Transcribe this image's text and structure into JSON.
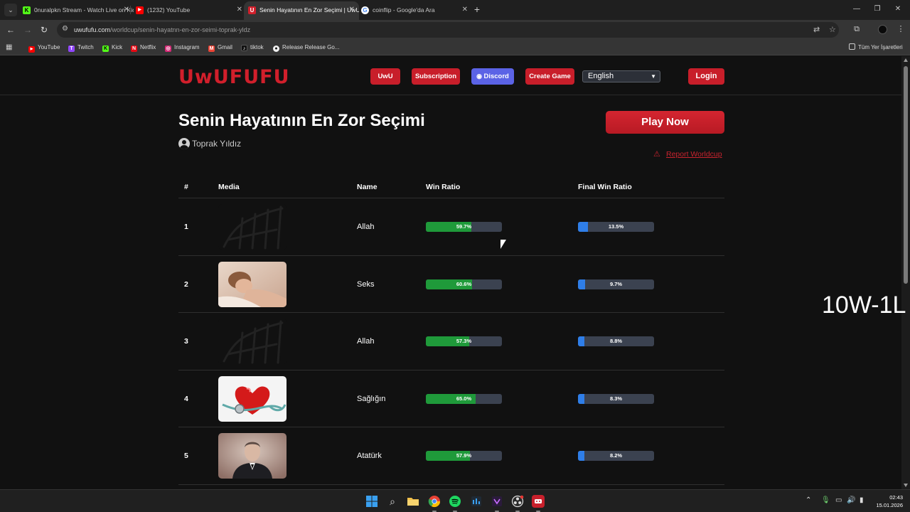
{
  "browser": {
    "tabs": [
      {
        "title": "0nuralpkn Stream - Watch Live on Kick",
        "favicon_color": "#53fc18",
        "favicon_letter": "K",
        "active": false
      },
      {
        "title": "(1232) YouTube",
        "favicon_color": "#ff0000",
        "favicon_letter": "▶",
        "active": false
      },
      {
        "title": "Senin Hayatının En Zor Seçimi | UwUFUFU",
        "favicon_color": "#d11f2b",
        "favicon_letter": "U",
        "active": true
      },
      {
        "title": "coinflip - Google'da Ara",
        "favicon_color": "#ffffff",
        "favicon_letter": "G",
        "active": false
      }
    ],
    "url_domain": "uwufufu.com",
    "url_path": "/worldcup/senin-hayatnn-en-zor-seimi-toprak-yldz",
    "bookmarks": [
      {
        "label": "YouTube",
        "color": "#ff0000",
        "glyph": "▶"
      },
      {
        "label": "Twitch",
        "color": "#9146ff",
        "glyph": "T"
      },
      {
        "label": "Kick",
        "color": "#53fc18",
        "glyph": "K"
      },
      {
        "label": "Netflix",
        "color": "#e50914",
        "glyph": "N"
      },
      {
        "label": "Instagram",
        "color": "#d62976",
        "glyph": "◎"
      },
      {
        "label": "Gmail",
        "color": "#ea4335",
        "glyph": "M"
      },
      {
        "label": "tiktok",
        "color": "#111111",
        "glyph": "♪"
      },
      {
        "label": "Release Release Go...",
        "color": "#f0f0f0",
        "glyph": "●"
      }
    ],
    "bookmarks_all": "Tüm Yer İşaretleri"
  },
  "site": {
    "logo": "UwUFUFU",
    "nav": {
      "uwu": "UwU",
      "subscription": "Subscription",
      "discord": "Discord",
      "create_game": "Create Game",
      "language": "English",
      "login": "Login"
    }
  },
  "worldcup": {
    "title": "Senin Hayatının En Zor Seçimi",
    "author": "Toprak Yıldız",
    "play_now": "Play Now",
    "report": "Report Worldcup"
  },
  "table": {
    "headers": {
      "rank": "#",
      "media": "Media",
      "name": "Name",
      "win_ratio": "Win Ratio",
      "final_win_ratio": "Final Win Ratio"
    },
    "rows": [
      {
        "rank": "1",
        "name": "Allah",
        "win_ratio": "59.7%",
        "win_value": 59.7,
        "final_ratio": "13.5%",
        "final_value": 13.5,
        "media": "calligraphy"
      },
      {
        "rank": "2",
        "name": "Seks",
        "win_ratio": "60.6%",
        "win_value": 60.6,
        "final_ratio": "9.7%",
        "final_value": 9.7,
        "media": "photo-person"
      },
      {
        "rank": "3",
        "name": "Allah",
        "win_ratio": "57.3%",
        "win_value": 57.3,
        "final_ratio": "8.8%",
        "final_value": 8.8,
        "media": "calligraphy"
      },
      {
        "rank": "4",
        "name": "Sağlığın",
        "win_ratio": "65.0%",
        "win_value": 65.0,
        "final_ratio": "8.3%",
        "final_value": 8.3,
        "media": "heart-stethoscope"
      },
      {
        "rank": "5",
        "name": "Atatürk",
        "win_ratio": "57.9%",
        "win_value": 57.9,
        "final_ratio": "8.2%",
        "final_value": 8.2,
        "media": "portrait"
      }
    ]
  },
  "overlay": {
    "score": "10W-1L"
  },
  "taskbar": {
    "time": "02:43",
    "date": "15.01.2026"
  }
}
